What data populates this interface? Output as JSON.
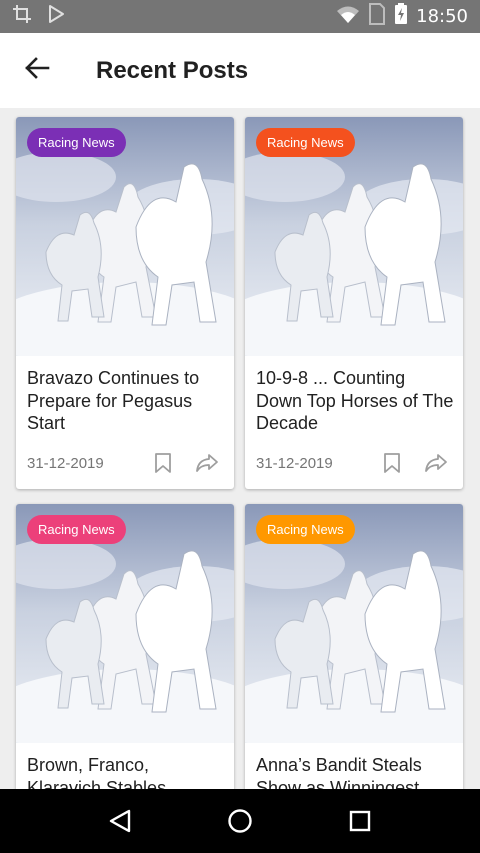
{
  "status_bar": {
    "time": "18:50",
    "icons": [
      "crop-icon",
      "play-store-icon",
      "wifi-icon",
      "sim-card-icon",
      "battery-charging-icon"
    ]
  },
  "app_bar": {
    "title": "Recent Posts",
    "back_icon": "arrow-left-icon"
  },
  "colors": {
    "badge_purple": "#7b2fb5",
    "badge_red": "#f4511e",
    "badge_pink": "#ec407a",
    "badge_orange": "#ff9800"
  },
  "posts": [
    {
      "category": "Racing News",
      "badge_color": "#7b2fb5",
      "title": "Bravazo Continues to Prepare for Pegasus Start",
      "date": "31-12-2019"
    },
    {
      "category": "Racing News",
      "badge_color": "#f4511e",
      "title": "10-9-8 ... Counting Down Top Horses of The Decade",
      "date": "31-12-2019"
    },
    {
      "category": "Racing News",
      "badge_color": "#ec407a",
      "title": "Brown, Franco, Klaravich Stables",
      "date": ""
    },
    {
      "category": "Racing News",
      "badge_color": "#ff9800",
      "title": "Anna’s Bandit Steals Show as Winningest",
      "date": ""
    }
  ],
  "nav_bar": {
    "icons": [
      "back-triangle-icon",
      "home-circle-icon",
      "recents-square-icon"
    ]
  }
}
